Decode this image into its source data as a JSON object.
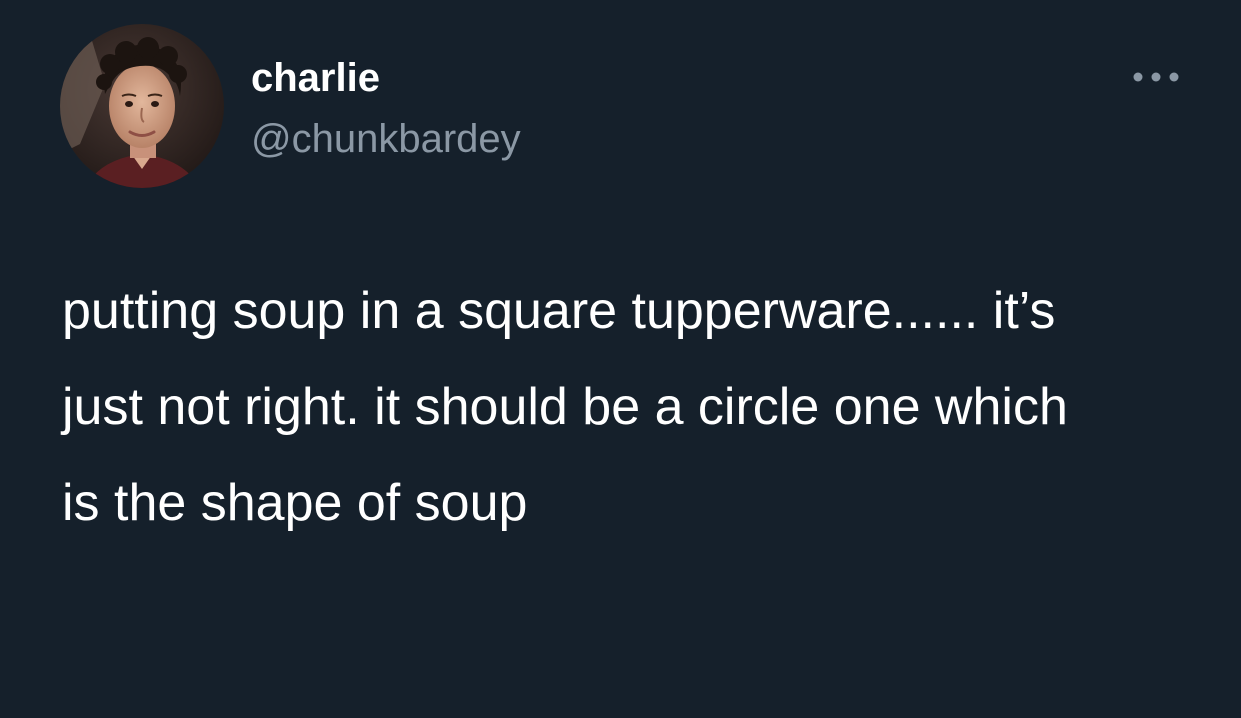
{
  "tweet": {
    "author": {
      "display_name": "charlie",
      "handle": "@chunkbardey",
      "avatar": "profile-photo"
    },
    "more_icon": "more-dots-icon",
    "text": "putting soup in a square tupperware...... it’s just not right. it should be a circle one which is the shape of soup"
  },
  "colors": {
    "background": "#15202b",
    "primary_text": "#ffffff",
    "secondary_text": "#8b98a5"
  }
}
